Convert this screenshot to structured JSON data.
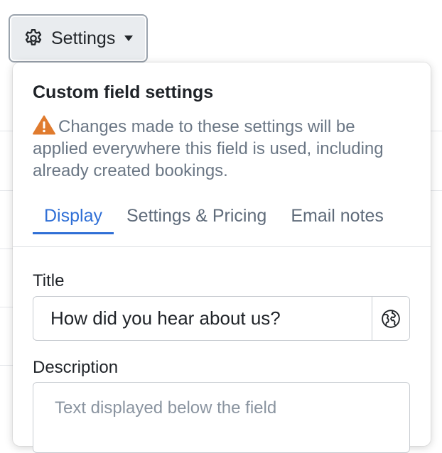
{
  "toolbar": {
    "settings_label": "Settings",
    "settings_icon": "gear-icon",
    "caret_icon": "caret-down-icon"
  },
  "panel": {
    "title": "Custom field settings",
    "warning_icon": "warning-icon",
    "warning_text": "Changes made to these settings will be applied everywhere this field is used, including already created bookings.",
    "tabs": [
      {
        "label": "Display",
        "active": true
      },
      {
        "label": "Settings & Pricing",
        "active": false
      },
      {
        "label": "Email notes",
        "active": false
      }
    ],
    "title_field": {
      "label": "Title",
      "value": "How did you hear about us?",
      "translate_icon": "globe-icon"
    },
    "description_field": {
      "label": "Description",
      "placeholder": "Text displayed below the field"
    }
  },
  "colors": {
    "accent": "#2f6fd6",
    "warning": "#e07b2e",
    "muted_text": "#6b7785"
  }
}
